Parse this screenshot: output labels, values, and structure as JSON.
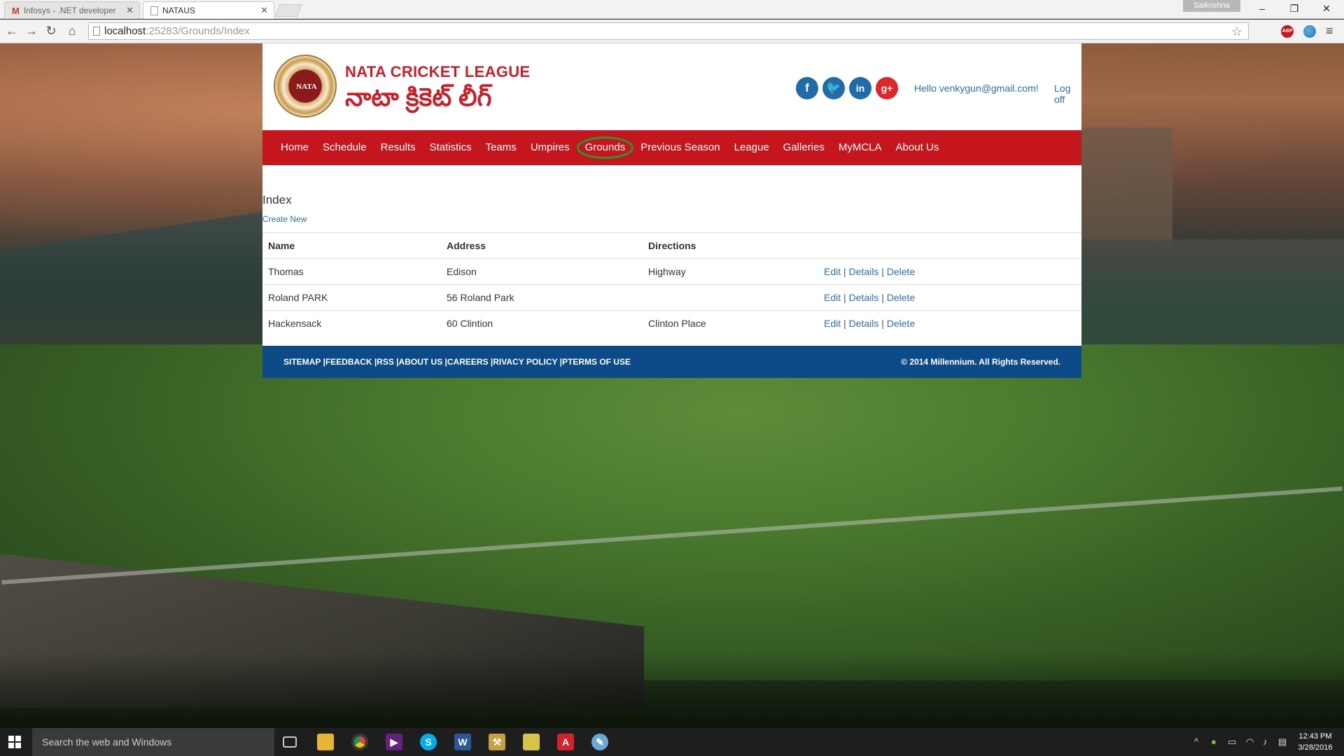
{
  "browser": {
    "tabs": [
      {
        "label": "Infosys - .NET developer",
        "active": false,
        "icon": "gmail-icon"
      },
      {
        "label": "NATAUS",
        "active": true,
        "icon": "page-icon"
      }
    ],
    "user": "Saikrishna",
    "window_controls": {
      "minimize": "–",
      "restore": "❐",
      "close": "✕"
    },
    "url": {
      "host": "localhost",
      "rest": ":25283/Grounds/Index"
    }
  },
  "site": {
    "brand_en": "NATA CRICKET LEAGUE",
    "brand_te": "నాటా క్రికెట్ లీగ్",
    "logo_text": "NATA",
    "social": [
      "f",
      "t",
      "in",
      "g+"
    ],
    "greeting": "Hello venkygun@gmail.com!",
    "logoff": "Log off",
    "nav": [
      "Home",
      "Schedule",
      "Results",
      "Statistics",
      "Teams",
      "Umpires",
      "Grounds",
      "Previous Season",
      "League",
      "Galleries",
      "MyMCLA",
      "About Us"
    ],
    "active_nav": "Grounds"
  },
  "page": {
    "heading": "Index",
    "create_new": "Create New",
    "columns": [
      "Name",
      "Address",
      "Directions"
    ],
    "rows": [
      {
        "name": "Thomas",
        "address": "Edison",
        "directions": "Highway"
      },
      {
        "name": "Roland PARK",
        "address": "56 Roland Park",
        "directions": ""
      },
      {
        "name": "Hackensack",
        "address": "60 Clintion",
        "directions": "Clinton Place"
      }
    ],
    "actions": {
      "edit": "Edit",
      "details": "Details",
      "delete": "Delete",
      "separator": "|"
    }
  },
  "footer": {
    "links": "SITEMAP |FEEDBACK |RSS |ABOUT US |CAREERS |RIVACY POLICY |PTERMS OF USE",
    "copyright": "© 2014 Millennium. All Rights Reserved."
  },
  "taskbar": {
    "search_placeholder": "Search the web and Windows",
    "time": "12:43 PM",
    "date": "3/28/2016"
  },
  "colors": {
    "brand_red": "#c4161c",
    "footer_blue": "#0d4a88",
    "link_blue": "#2a6fb4",
    "active_circle": "#1f9a3b"
  }
}
